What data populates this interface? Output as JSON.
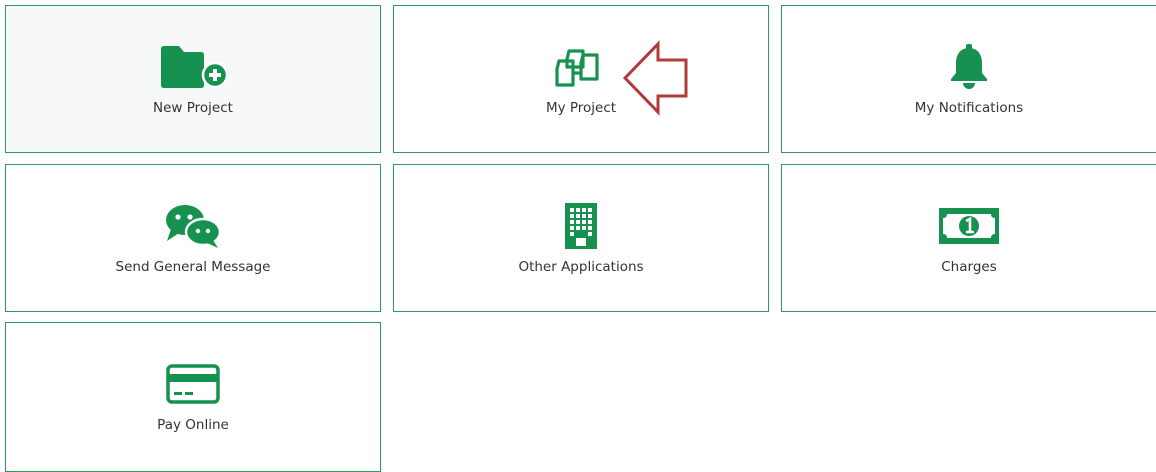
{
  "colors": {
    "accent": "#169150",
    "tile_border": "#2e9a5f",
    "annotation": "#b33a3a"
  },
  "tiles": [
    {
      "id": "new-project",
      "label": "New Project",
      "icon": "folder-plus-icon"
    },
    {
      "id": "my-project",
      "label": "My Project",
      "icon": "copy-documents-icon"
    },
    {
      "id": "my-notifications",
      "label": "My Notifications",
      "icon": "bell-icon"
    },
    {
      "id": "send-general-message",
      "label": "Send General Message",
      "icon": "chat-bubbles-icon"
    },
    {
      "id": "other-applications",
      "label": "Other Applications",
      "icon": "building-icon"
    },
    {
      "id": "charges",
      "label": "Charges",
      "icon": "banknote-icon"
    },
    {
      "id": "pay-online",
      "label": "Pay Online",
      "icon": "credit-card-icon"
    }
  ],
  "annotation": {
    "icon": "left-arrow-outline-icon",
    "points_to": "my-project"
  }
}
